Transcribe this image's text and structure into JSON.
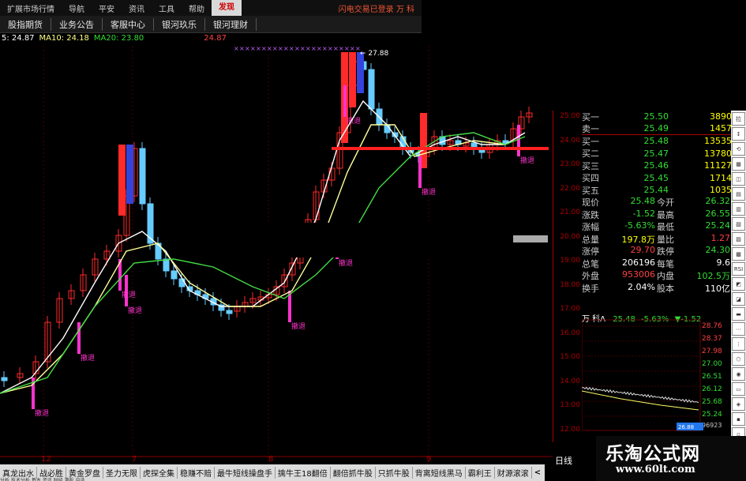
{
  "menu": {
    "items": [
      "扩展市场行情",
      "导航",
      "平安",
      "资讯",
      "工具",
      "帮助",
      "发现"
    ],
    "active": "发现",
    "ticker": "闪电交易已登录   万 科"
  },
  "nav": [
    "股指期货",
    "业务公告",
    "客服中心",
    "银河玖乐",
    "银河理财"
  ],
  "ma_legend": {
    "ma5": "5: 24.87",
    "ma10": "MA10: 24.18",
    "ma20": "MA20: 23.80",
    "extra": "24.87",
    "colors": {
      "ma5": "#ffffff",
      "ma10": "#ffff80",
      "ma20": "#33dd33",
      "extra": "#ff4040"
    }
  },
  "chart": {
    "peak_label": "27.88",
    "signal_label": "撤退",
    "colors": {
      "up": "#ff2a2a",
      "down": "#66ccff",
      "signal": "#ff33cc",
      "ma5": "#ffffff",
      "ma10": "#ffff99",
      "ma20": "#44dd44",
      "base": "#ff2020"
    }
  },
  "axis_right": [
    "25.00",
    "24.00",
    "23.00",
    "22.00",
    "21.00",
    "20.00",
    "19.00",
    "18.00",
    "17.00",
    "16.00",
    "15.00",
    "14.00",
    "13.00",
    "12.00"
  ],
  "x_labels": [
    "12",
    "7",
    "8",
    "9"
  ],
  "quote": {
    "orders": [
      {
        "label": "买一",
        "price": "25.50",
        "vol": "3890"
      },
      {
        "label": "卖一",
        "price": "25.49",
        "vol": "1457"
      },
      {
        "label": "买一",
        "price": "25.48",
        "vol": "13535"
      },
      {
        "label": "买二",
        "price": "25.47",
        "vol": "13780"
      },
      {
        "label": "买三",
        "price": "25.46",
        "vol": "11127"
      },
      {
        "label": "买四",
        "price": "25.45",
        "vol": "1714"
      },
      {
        "label": "买五",
        "price": "25.44",
        "vol": "1035"
      }
    ],
    "stats": [
      [
        {
          "l": "现价",
          "v": "25.48",
          "c": "#33dd33"
        },
        {
          "l": "今开",
          "v": "26.32",
          "c": "#33dd33"
        }
      ],
      [
        {
          "l": "涨跌",
          "v": "-1.52",
          "c": "#33dd33"
        },
        {
          "l": "最高",
          "v": "26.55",
          "c": "#33dd33"
        }
      ],
      [
        {
          "l": "涨幅",
          "v": "-5.63%",
          "c": "#33dd33"
        },
        {
          "l": "最低",
          "v": "25.24",
          "c": "#33dd33"
        }
      ],
      [
        {
          "l": "总量",
          "v": "197.8万",
          "c": "#ffff00"
        },
        {
          "l": "量比",
          "v": "1.27",
          "c": "#ff4040"
        }
      ],
      [
        {
          "l": "涨停",
          "v": "29.70",
          "c": "#ff4040"
        },
        {
          "l": "跌停",
          "v": "24.30",
          "c": "#33dd33"
        }
      ],
      [
        {
          "l": "总笔",
          "v": "206196",
          "c": "#ffffff"
        },
        {
          "l": "每笔",
          "v": "9.6",
          "c": "#ffffff"
        }
      ],
      [
        {
          "l": "外盘",
          "v": "953006",
          "c": "#ff4040"
        },
        {
          "l": "内盘",
          "v": "102.5万",
          "c": "#33dd33"
        }
      ],
      [
        {
          "l": "换手",
          "v": "2.04%",
          "c": "#ffffff"
        },
        {
          "l": "股本",
          "v": "110亿",
          "c": "#ffffff"
        }
      ]
    ]
  },
  "mini": {
    "title": "万 科A",
    "price": "25.48",
    "pct": "-5.63%",
    "chg": "▼-1.52",
    "axis": [
      "28.76",
      "28.37",
      "27.98",
      "27.00",
      "26.51",
      "26.12",
      "25.68",
      "25.24"
    ],
    "bottom_left": "26.88",
    "bottom_right": "96923"
  },
  "sidebar_icons": [
    "拉",
    "↕",
    "⟲",
    "▦",
    "◫",
    "▤",
    "▥",
    "▧",
    "▨",
    "▩",
    "RSI",
    "◩",
    "◪",
    "▬",
    "⋯",
    "⋮",
    "⬡",
    "◉",
    "▭",
    "◈",
    "▪",
    "▫"
  ],
  "tabs": [
    "真龙出水",
    "战必胜",
    "黄金罗盘",
    "圣力无限",
    "虎探全集",
    "稳赚不赔",
    "最牛短线操盘手",
    "擒牛王18翻倍",
    "翻倍抓牛股",
    "只抓牛股",
    "背离短线黑马",
    "霸利王",
    "财源滚滚",
    "<",
    ">"
  ],
  "tab_row2": "分析  技术分析  基本  资讯  财经  港股  自选",
  "day_label": "日线",
  "logo": {
    "main": "乐淘公式网",
    "sub": "www.60lt.com"
  }
}
